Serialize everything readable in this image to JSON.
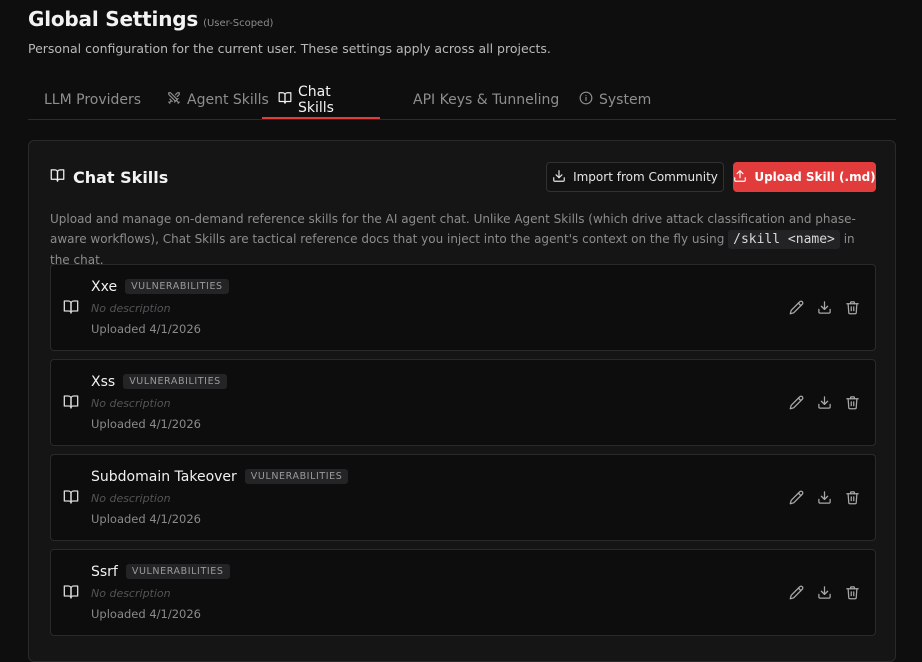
{
  "header": {
    "title": "Global Settings",
    "scope_tag": "(User-Scoped)",
    "subtitle": "Personal configuration for the current user. These settings apply across all projects."
  },
  "tabs": [
    {
      "label": "LLM Providers",
      "icon": null
    },
    {
      "label": "Agent Skills",
      "icon": "crossed-swords-icon"
    },
    {
      "label": "Chat Skills",
      "icon": "book-open-icon",
      "active": true
    },
    {
      "label": "API Keys & Tunneling",
      "icon": null
    },
    {
      "label": "System",
      "icon": "info-icon"
    }
  ],
  "panel": {
    "title": "Chat Skills",
    "import_label": "Import from Community",
    "upload_label": "Upload Skill (.md)",
    "description_before": "Upload and manage on-demand reference skills for the AI agent chat. Unlike Agent Skills (which drive attack classification and phase-aware workflows), Chat Skills are tactical reference docs that you inject into the agent's context on the fly using ",
    "description_code": "/skill <name>",
    "description_after": " in the chat."
  },
  "skills": [
    {
      "name": "Xxe",
      "category": "VULNERABILITIES",
      "description": "No description",
      "uploaded": "Uploaded 4/1/2026"
    },
    {
      "name": "Xss",
      "category": "VULNERABILITIES",
      "description": "No description",
      "uploaded": "Uploaded 4/1/2026"
    },
    {
      "name": "Subdomain Takeover",
      "category": "VULNERABILITIES",
      "description": "No description",
      "uploaded": "Uploaded 4/1/2026"
    },
    {
      "name": "Ssrf",
      "category": "VULNERABILITIES",
      "description": "No description",
      "uploaded": "Uploaded 4/1/2026"
    }
  ],
  "colors": {
    "accent": "#e23b3b",
    "background": "#0e0e0f",
    "panel": "#151516"
  }
}
